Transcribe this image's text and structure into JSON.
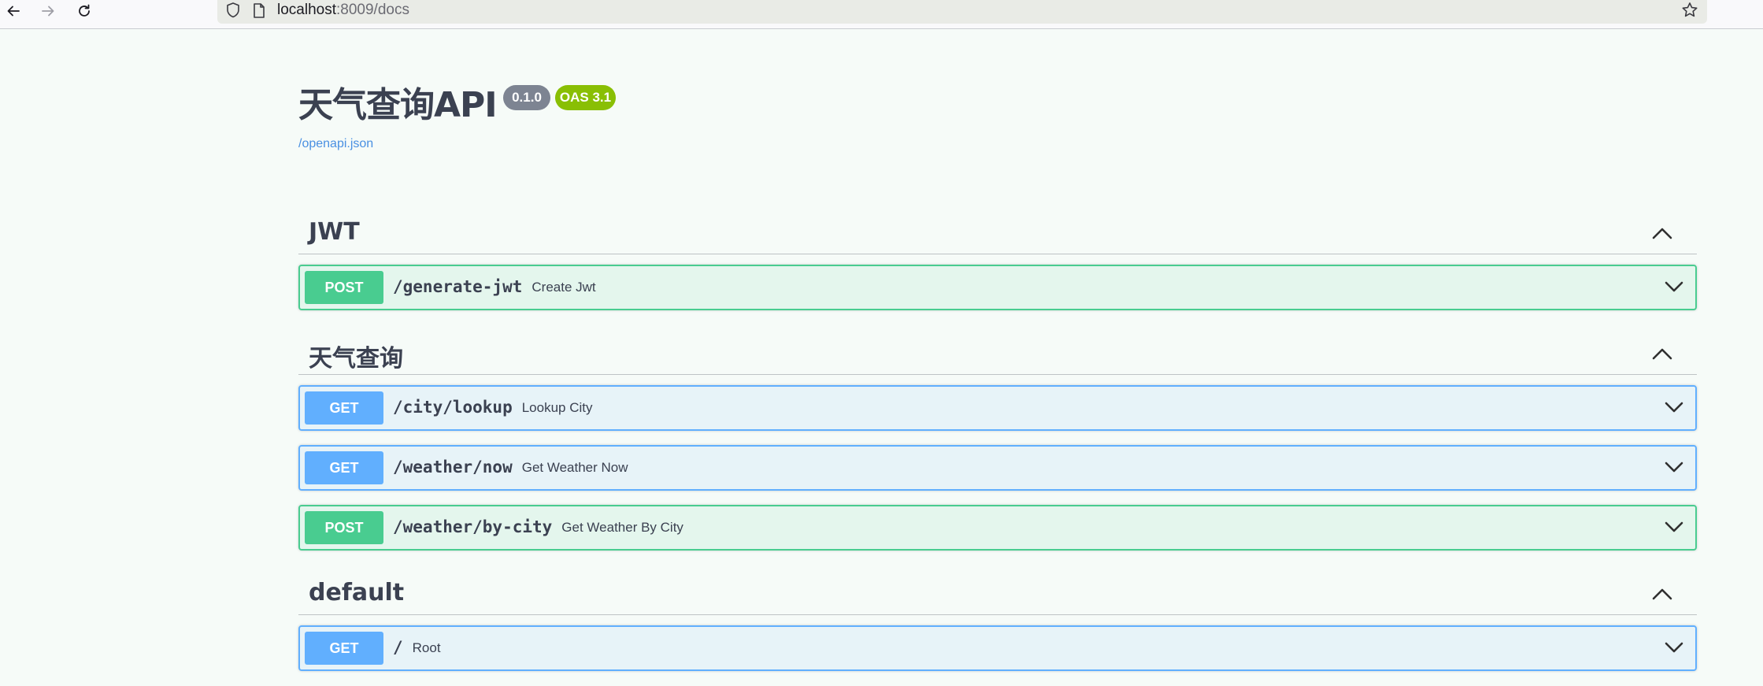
{
  "browser": {
    "url_host": "localhost",
    "url_rest": ":8009/docs"
  },
  "info": {
    "title": "天气查询API",
    "version": "0.1.0",
    "oas_version": "OAS 3.1",
    "spec_link": "/openapi.json",
    "version_color": "#7d8492",
    "oas_color": "#89bf04"
  },
  "tags": [
    {
      "name": "JWT",
      "operations": [
        {
          "method": "POST",
          "path": "/generate-jwt",
          "summary": "Create Jwt"
        }
      ]
    },
    {
      "name": "天气查询",
      "operations": [
        {
          "method": "GET",
          "path": "/city/lookup",
          "summary": "Lookup City"
        },
        {
          "method": "GET",
          "path": "/weather/now",
          "summary": "Get Weather Now"
        },
        {
          "method": "POST",
          "path": "/weather/by-city",
          "summary": "Get Weather By City"
        }
      ]
    },
    {
      "name": "default",
      "operations": [
        {
          "method": "GET",
          "path": "/",
          "summary": "Root"
        }
      ]
    }
  ],
  "icons": {
    "back": "arrow-left-icon",
    "forward": "arrow-right-icon",
    "reload": "reload-icon",
    "shield": "shield-icon",
    "page": "page-icon",
    "star": "star-icon",
    "collapse": "chevron-up-icon",
    "expand": "chevron-down-icon"
  },
  "colors": {
    "post": "#49cc90",
    "get": "#61affe",
    "link": "#4990e2",
    "text": "#3b4151"
  }
}
